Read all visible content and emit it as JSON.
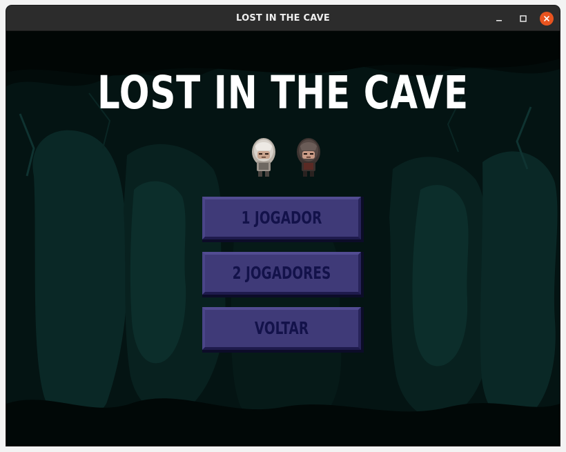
{
  "window": {
    "title": "LOST IN THE CAVE",
    "controls": [
      "minimize-icon",
      "maximize-icon",
      "close-icon"
    ]
  },
  "game": {
    "title": "LOST IN THE CAVE",
    "characters": [
      {
        "name": "light-haired hooded character",
        "icon": "character-sprite-icon"
      },
      {
        "name": "dark hooded character",
        "icon": "character-sprite-icon"
      }
    ],
    "menu": [
      {
        "label": "1 JOGADOR"
      },
      {
        "label": "2 JOGADORES"
      },
      {
        "label": "VOLTAR"
      }
    ]
  },
  "colors": {
    "titlebar": "#2c2c2c",
    "background": "#020b0a",
    "cave": "#0b2a28",
    "button_face": "#3f3a78",
    "button_text": "#13124a",
    "close_button": "#e9541f"
  }
}
